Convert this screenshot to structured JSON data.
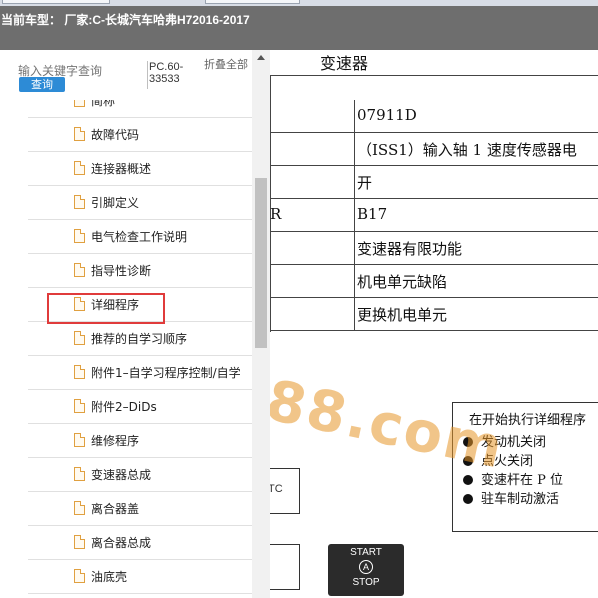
{
  "header": {
    "title": "当前车型：  厂家:C-长城汽车哈弗H72016-2017"
  },
  "sidebar": {
    "search_placeholder": "输入关键字查询",
    "search_button": "查询",
    "model_code": "PC.60-33533",
    "collapse_all": "折叠全部",
    "items": [
      {
        "label": "简称"
      },
      {
        "label": "故障代码"
      },
      {
        "label": "连接器概述"
      },
      {
        "label": "引脚定义"
      },
      {
        "label": "电气检查工作说明"
      },
      {
        "label": "指导性诊断"
      },
      {
        "label": "详细程序"
      },
      {
        "label": "推荐的自学习顺序"
      },
      {
        "label": "附件1–自学习程序控制/自学"
      },
      {
        "label": "附件2–DiDs"
      },
      {
        "label": "维修程序"
      },
      {
        "label": "变速器总成"
      },
      {
        "label": "离合器盖"
      },
      {
        "label": "离合器总成"
      },
      {
        "label": "油底壳"
      }
    ],
    "selected_item": "详细程序"
  },
  "content": {
    "section_title": "变速器",
    "rows": [
      {
        "key": "",
        "value": "07911D"
      },
      {
        "key": "",
        "value": "（ISS1）输入轴 1 速度传感器电"
      },
      {
        "key": "",
        "value": "开"
      },
      {
        "key": "R",
        "value": "B17"
      },
      {
        "key": "",
        "value": "变速器有限功能"
      },
      {
        "key": "",
        "value": "机电单元缺陷"
      },
      {
        "key": "",
        "value": "更换机电单元"
      }
    ],
    "preconditions": {
      "title": "在开始执行详细程序",
      "items": [
        "发动机关闭",
        "点火关闭",
        "变速杆在 P 位",
        "驻车制动激活"
      ]
    },
    "tc_label": "TC",
    "start_button": {
      "line1": "START",
      "symbol": "A",
      "line2": "STOP"
    },
    "watermark": "88.com"
  }
}
